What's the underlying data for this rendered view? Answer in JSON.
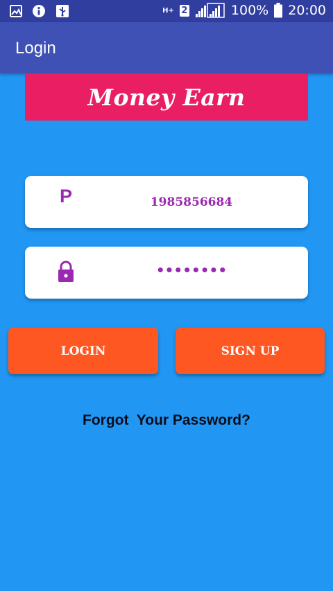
{
  "status_bar": {
    "network_type": "H+",
    "sim_number": "2",
    "battery": "100%",
    "time": "20:00",
    "icons": [
      "gallery-icon",
      "info-icon",
      "usb-icon",
      "signal-icon",
      "battery-icon"
    ]
  },
  "app_bar": {
    "title": "Login"
  },
  "banner": {
    "text": "Money Earn"
  },
  "form": {
    "phone_label_icon": "P",
    "phone_value": "1985856684",
    "password_value": "••••••••"
  },
  "buttons": {
    "login": "LOGIN",
    "signup": "SIGN UP"
  },
  "links": {
    "forgot": "Forgot  Your Password?"
  },
  "colors": {
    "background": "#2196F3",
    "status_bar": "#303F9F",
    "app_bar": "#3F51B5",
    "banner": "#E91E63",
    "accent_purple": "#9C27B0",
    "button": "#FF5722"
  }
}
